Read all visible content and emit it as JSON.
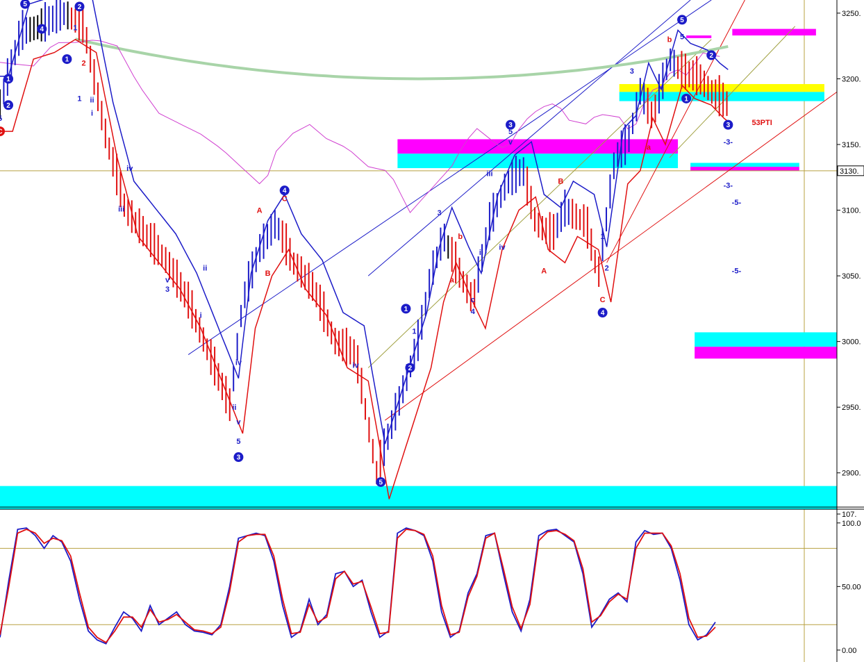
{
  "chart_data": [
    {
      "type": "line",
      "panel": "price",
      "y_axis": {
        "ylim": [
          2875,
          3260
        ],
        "ticks": [
          "3250.",
          "3200.",
          "3150.",
          "3100.",
          "3050.",
          "3000.",
          "2950.",
          "2900."
        ],
        "tick_values": [
          3250,
          3200,
          3150,
          3100,
          3050,
          3000,
          2950,
          2900
        ],
        "last_price_label": "3130.",
        "last_price_value": 3130
      },
      "x_range": [
        0,
        200
      ],
      "price_series_sample": [
        {
          "x": 0,
          "v": 3180
        },
        {
          "x": 5,
          "v": 3235
        },
        {
          "x": 10,
          "v": 3240
        },
        {
          "x": 15,
          "v": 3250
        },
        {
          "x": 20,
          "v": 3240
        },
        {
          "x": 25,
          "v": 3160
        },
        {
          "x": 30,
          "v": 3100
        },
        {
          "x": 35,
          "v": 3080
        },
        {
          "x": 40,
          "v": 3060
        },
        {
          "x": 45,
          "v": 3030
        },
        {
          "x": 50,
          "v": 2990
        },
        {
          "x": 55,
          "v": 2950
        },
        {
          "x": 58,
          "v": 3030
        },
        {
          "x": 62,
          "v": 3070
        },
        {
          "x": 66,
          "v": 3090
        },
        {
          "x": 70,
          "v": 3060
        },
        {
          "x": 75,
          "v": 3040
        },
        {
          "x": 80,
          "v": 3000
        },
        {
          "x": 85,
          "v": 2990
        },
        {
          "x": 90,
          "v": 2900
        },
        {
          "x": 95,
          "v": 2950
        },
        {
          "x": 100,
          "v": 3000
        },
        {
          "x": 103,
          "v": 3050
        },
        {
          "x": 106,
          "v": 3080
        },
        {
          "x": 110,
          "v": 3050
        },
        {
          "x": 113,
          "v": 3030
        },
        {
          "x": 117,
          "v": 3090
        },
        {
          "x": 121,
          "v": 3120
        },
        {
          "x": 125,
          "v": 3130
        },
        {
          "x": 128,
          "v": 3090
        },
        {
          "x": 132,
          "v": 3080
        },
        {
          "x": 135,
          "v": 3100
        },
        {
          "x": 140,
          "v": 3090
        },
        {
          "x": 143,
          "v": 3050
        },
        {
          "x": 147,
          "v": 3140
        },
        {
          "x": 150,
          "v": 3150
        },
        {
          "x": 153,
          "v": 3190
        },
        {
          "x": 156,
          "v": 3170
        },
        {
          "x": 160,
          "v": 3215
        },
        {
          "x": 163,
          "v": 3205
        },
        {
          "x": 167,
          "v": 3200
        },
        {
          "x": 170,
          "v": 3190
        },
        {
          "x": 174,
          "v": 3180
        }
      ],
      "labels": [
        {
          "text": "5",
          "x": 0,
          "v": 3168,
          "color": "blue"
        },
        {
          "text": "1",
          "x": 18,
          "v": 3237,
          "color": "blue"
        },
        {
          "text": "2",
          "x": 20,
          "v": 3210,
          "color": "red"
        },
        {
          "text": "1",
          "x": 19,
          "v": 3183,
          "color": "blue"
        },
        {
          "text": "ii",
          "x": 22,
          "v": 3182,
          "color": "blue"
        },
        {
          "text": "i",
          "x": 22,
          "v": 3172,
          "color": "blue"
        },
        {
          "text": "iv",
          "x": 31,
          "v": 3130,
          "color": "blue"
        },
        {
          "text": "iii",
          "x": 29,
          "v": 3099,
          "color": "blue"
        },
        {
          "text": "v",
          "x": 40,
          "v": 3045,
          "color": "blue"
        },
        {
          "text": "3",
          "x": 40,
          "v": 3038,
          "color": "blue"
        },
        {
          "text": "ii",
          "x": 49,
          "v": 3054,
          "color": "blue"
        },
        {
          "text": "i",
          "x": 48,
          "v": 3018,
          "color": "blue"
        },
        {
          "text": "iv",
          "x": 57,
          "v": 2982,
          "color": "blue"
        },
        {
          "text": "ii",
          "x": 56,
          "v": 2948,
          "color": "blue"
        },
        {
          "text": "v",
          "x": 57,
          "v": 2937,
          "color": "blue"
        },
        {
          "text": "5",
          "x": 57,
          "v": 2922,
          "color": "blue"
        },
        {
          "text": "A",
          "x": 62,
          "v": 3098,
          "color": "red"
        },
        {
          "text": "B",
          "x": 64,
          "v": 3050,
          "color": "red"
        },
        {
          "text": "C",
          "x": 68,
          "v": 3107,
          "color": "red"
        },
        {
          "text": "iv",
          "x": 85,
          "v": 2980,
          "color": "blue"
        },
        {
          "text": "1",
          "x": 99,
          "v": 3006,
          "color": "blue"
        },
        {
          "text": "3",
          "x": 105,
          "v": 3096,
          "color": "blue"
        },
        {
          "text": "b",
          "x": 110,
          "v": 3078,
          "color": "red"
        },
        {
          "text": "a",
          "x": 108,
          "v": 3045,
          "color": "red"
        },
        {
          "text": "c",
          "x": 113,
          "v": 3030,
          "color": "blue"
        },
        {
          "text": "4",
          "x": 113,
          "v": 3021,
          "color": "blue"
        },
        {
          "text": "ii",
          "x": 115,
          "v": 3066,
          "color": "blue"
        },
        {
          "text": "iii",
          "x": 117,
          "v": 3126,
          "color": "blue"
        },
        {
          "text": "iv",
          "x": 120,
          "v": 3070,
          "color": "blue"
        },
        {
          "text": "5",
          "x": 122,
          "v": 3158,
          "color": "blue"
        },
        {
          "text": "v",
          "x": 122,
          "v": 3150,
          "color": "blue"
        },
        {
          "text": "A",
          "x": 130,
          "v": 3052,
          "color": "red"
        },
        {
          "text": "B",
          "x": 134,
          "v": 3120,
          "color": "red"
        },
        {
          "text": "1",
          "x": 144,
          "v": 3078,
          "color": "blue"
        },
        {
          "text": "2",
          "x": 145,
          "v": 3054,
          "color": "blue"
        },
        {
          "text": "C",
          "x": 144,
          "v": 3030,
          "color": "red"
        },
        {
          "text": "3",
          "x": 151,
          "v": 3204,
          "color": "blue"
        },
        {
          "text": "a",
          "x": 155,
          "v": 3146,
          "color": "red"
        },
        {
          "text": "b",
          "x": 160,
          "v": 3228,
          "color": "red"
        },
        {
          "text": "5",
          "x": 163,
          "v": 3230,
          "color": "blue"
        },
        {
          "text": "-3-",
          "x": 174,
          "v": 3150,
          "color": "blue"
        },
        {
          "text": "-3-",
          "x": 174,
          "v": 3117,
          "color": "blue"
        },
        {
          "text": "-5-",
          "x": 176,
          "v": 3104,
          "color": "blue"
        },
        {
          "text": "-5-",
          "x": 176,
          "v": 3052,
          "color": "blue"
        }
      ],
      "circled_labels": [
        {
          "text": "5",
          "x": 6,
          "v": 3257,
          "color": "blue"
        },
        {
          "text": "1",
          "x": 2,
          "v": 3200,
          "color": "blue"
        },
        {
          "text": "2",
          "x": 2,
          "v": 3180,
          "color": "blue"
        },
        {
          "text": "C",
          "x": 0,
          "v": 3160,
          "color": "red"
        },
        {
          "text": "4",
          "x": 10,
          "v": 3238,
          "color": "blue"
        },
        {
          "text": "1",
          "x": 16,
          "v": 3215,
          "color": "blue"
        },
        {
          "text": "2",
          "x": 19,
          "v": 3255,
          "color": "blue"
        },
        {
          "text": "3",
          "x": 57,
          "v": 2912,
          "color": "blue"
        },
        {
          "text": "4",
          "x": 68,
          "v": 3115,
          "color": "blue"
        },
        {
          "text": "5",
          "x": 91,
          "v": 2893,
          "color": "blue"
        },
        {
          "text": "1",
          "x": 97,
          "v": 3025,
          "color": "blue"
        },
        {
          "text": "2",
          "x": 98,
          "v": 2980,
          "color": "blue"
        },
        {
          "text": "3",
          "x": 122,
          "v": 3165,
          "color": "blue"
        },
        {
          "text": "4",
          "x": 144,
          "v": 3022,
          "color": "blue"
        },
        {
          "text": "5",
          "x": 163,
          "v": 3245,
          "color": "blue"
        },
        {
          "text": "1",
          "x": 164,
          "v": 3185,
          "color": "blue"
        },
        {
          "text": "2",
          "x": 170,
          "v": 3218,
          "color": "blue"
        },
        {
          "text": "3",
          "x": 174,
          "v": 3165,
          "color": "blue"
        }
      ],
      "annotation": {
        "text": "53PTI",
        "x": 178,
        "v": 3167,
        "color": "red"
      },
      "zones": [
        {
          "color": "#00ffff",
          "v_top": 2890,
          "v_bottom": 2872,
          "x_from": 0,
          "x_to": 200
        },
        {
          "color": "#ff00ff",
          "v_top": 3154,
          "v_bottom": 3143,
          "x_from": 95,
          "x_to": 162
        },
        {
          "color": "#00ffff",
          "v_top": 3143,
          "v_bottom": 3132,
          "x_from": 95,
          "x_to": 162
        },
        {
          "color": "#ffff00",
          "v_top": 3196,
          "v_bottom": 3190,
          "x_from": 148,
          "x_to": 197
        },
        {
          "color": "#00ffff",
          "v_top": 3190,
          "v_bottom": 3183,
          "x_from": 148,
          "x_to": 197
        },
        {
          "color": "#ff00ff",
          "v_top": 3238,
          "v_bottom": 3233,
          "x_from": 175,
          "x_to": 195
        },
        {
          "color": "#ff00ff",
          "v_top": 3233,
          "v_bottom": 3231,
          "x_from": 164,
          "x_to": 170
        },
        {
          "color": "#00ffff",
          "v_top": 3136,
          "v_bottom": 3133,
          "x_from": 165,
          "x_to": 191
        },
        {
          "color": "#ff00ff",
          "v_top": 3133,
          "v_bottom": 3130,
          "x_from": 165,
          "x_to": 191
        },
        {
          "color": "#00ffff",
          "v_top": 3007,
          "v_bottom": 2996,
          "x_from": 166,
          "x_to": 200
        },
        {
          "color": "#ff00ff",
          "v_top": 2996,
          "v_bottom": 2987,
          "x_from": 166,
          "x_to": 200
        }
      ],
      "colors": {
        "up_bar": "#1c1cc8",
        "down_bar": "#e01010",
        "neutral_bar": "#000000",
        "upper_band": "#1c1cc8",
        "lower_band": "#e01010",
        "ma_long": "#a8d4a8",
        "ma_mid": "#d040d0",
        "trendline_blue": "#1c1cc8",
        "trendline_red": "#e01010",
        "trendline_olive": "#a0a040"
      }
    },
    {
      "type": "line",
      "panel": "oscillator",
      "y_axis": {
        "ylim": [
          -5,
          107
        ],
        "ticks": [
          "107.",
          "100.0",
          "50.00",
          "0.00"
        ],
        "tick_values": [
          107,
          100,
          50,
          0
        ]
      },
      "reference_lines": [
        80,
        20
      ],
      "series": [
        {
          "color": "#1c1cc8",
          "values": [
            10,
            55,
            95,
            96,
            90,
            80,
            90,
            85,
            70,
            40,
            15,
            8,
            5,
            18,
            30,
            25,
            15,
            35,
            20,
            25,
            30,
            20,
            15,
            14,
            12,
            20,
            50,
            88,
            90,
            92,
            90,
            70,
            35,
            10,
            15,
            40,
            20,
            28,
            60,
            62,
            50,
            55,
            30,
            10,
            15,
            92,
            96,
            94,
            90,
            70,
            30,
            10,
            15,
            45,
            60,
            90,
            92,
            60,
            30,
            15,
            40,
            90,
            94,
            95,
            90,
            85,
            60,
            18,
            28,
            40,
            45,
            38,
            85,
            94,
            91,
            92,
            80,
            55,
            20,
            8,
            12,
            22
          ]
        },
        {
          "color": "#e01010",
          "values": [
            12,
            50,
            92,
            95,
            92,
            84,
            88,
            86,
            74,
            45,
            18,
            10,
            6,
            15,
            26,
            26,
            18,
            32,
            22,
            24,
            28,
            22,
            16,
            15,
            13,
            18,
            46,
            85,
            90,
            91,
            91,
            74,
            40,
            13,
            14,
            36,
            22,
            26,
            56,
            62,
            52,
            54,
            34,
            13,
            14,
            88,
            95,
            94,
            91,
            74,
            35,
            12,
            14,
            42,
            58,
            88,
            92,
            64,
            34,
            17,
            36,
            86,
            93,
            94,
            91,
            86,
            64,
            22,
            27,
            38,
            44,
            40,
            80,
            92,
            92,
            92,
            82,
            60,
            25,
            10,
            11,
            18
          ]
        }
      ]
    }
  ]
}
